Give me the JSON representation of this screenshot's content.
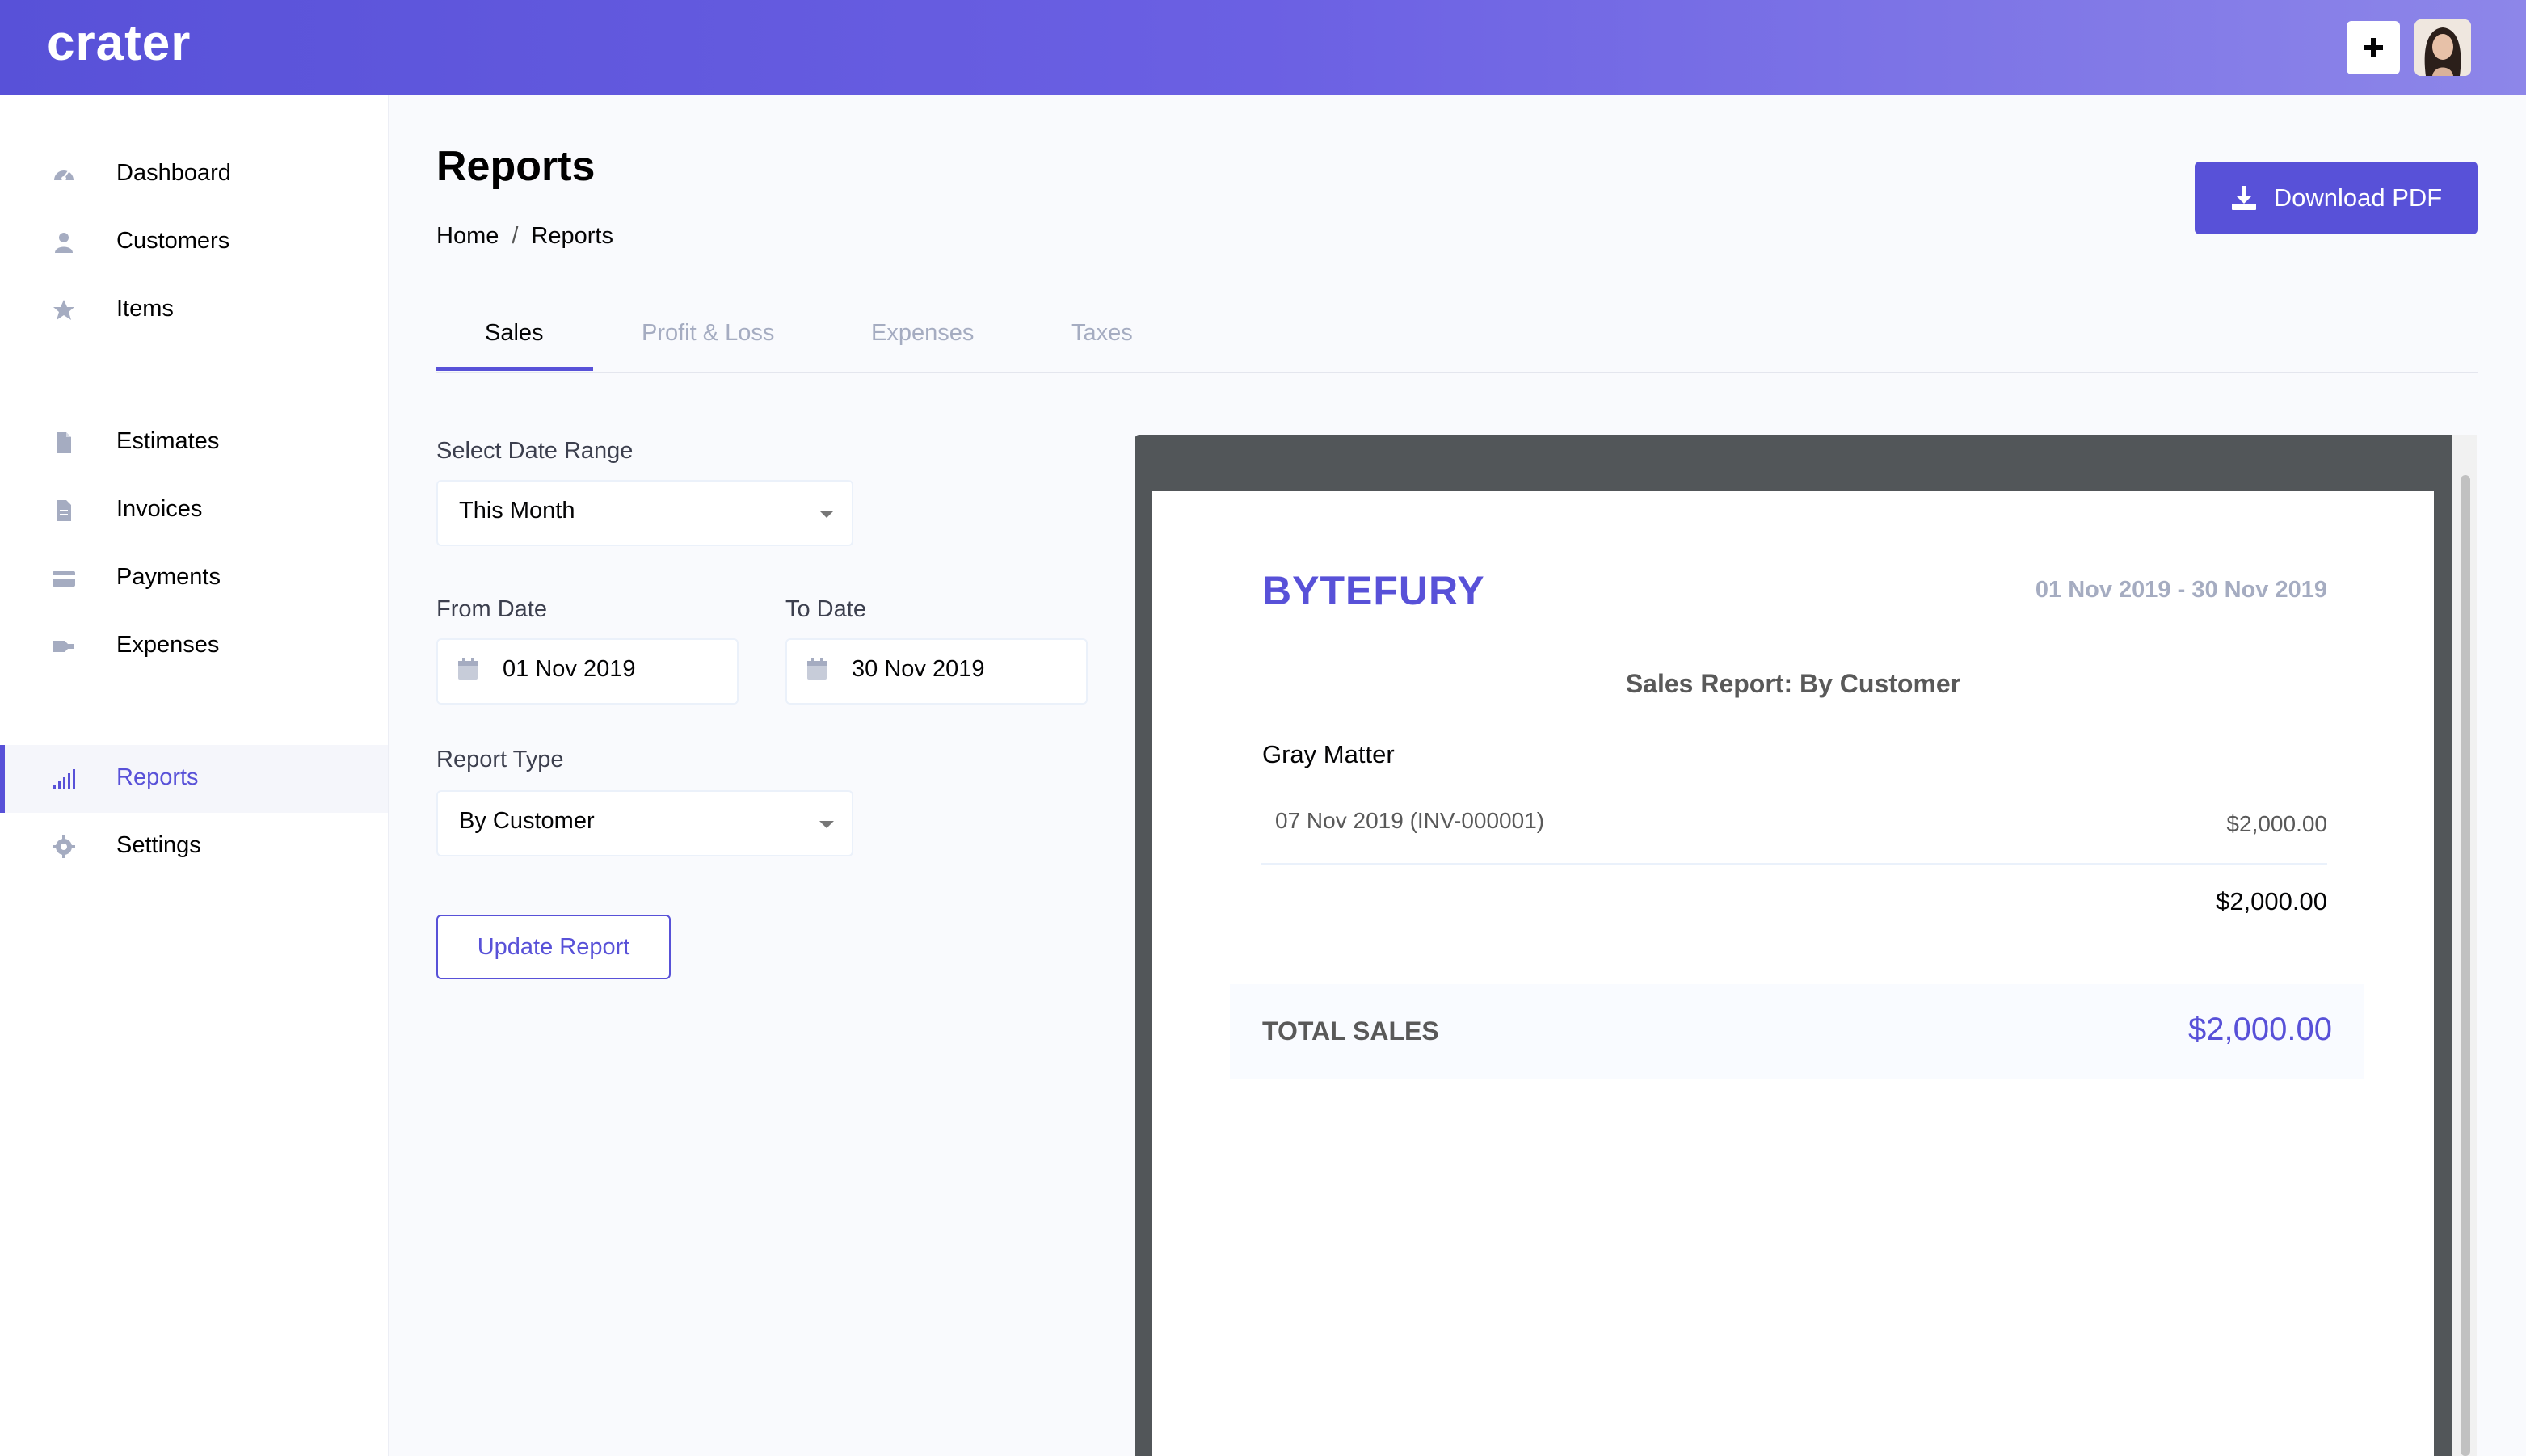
{
  "header": {
    "logo": "crater",
    "plus_icon": "plus-icon",
    "avatar_icon": "user-avatar"
  },
  "sidebar": {
    "items": [
      {
        "label": "Dashboard",
        "icon": "dashboard-icon"
      },
      {
        "label": "Customers",
        "icon": "user-icon"
      },
      {
        "label": "Items",
        "icon": "star-icon"
      },
      {
        "label": "Estimates",
        "icon": "document-icon"
      },
      {
        "label": "Invoices",
        "icon": "file-icon"
      },
      {
        "label": "Payments",
        "icon": "credit-card-icon"
      },
      {
        "label": "Expenses",
        "icon": "key-icon"
      },
      {
        "label": "Reports",
        "icon": "signal-icon",
        "active": true
      },
      {
        "label": "Settings",
        "icon": "gear-icon"
      }
    ]
  },
  "page": {
    "title": "Reports",
    "breadcrumb": {
      "home": "Home",
      "separator": "/",
      "current": "Reports"
    },
    "download_label": "Download PDF"
  },
  "tabs": [
    {
      "label": "Sales",
      "active": true
    },
    {
      "label": "Profit & Loss"
    },
    {
      "label": "Expenses"
    },
    {
      "label": "Taxes"
    }
  ],
  "form": {
    "date_range_label": "Select Date Range",
    "date_range_value": "This Month",
    "from_label": "From Date",
    "from_value": "01 Nov 2019",
    "to_label": "To Date",
    "to_value": "30 Nov 2019",
    "report_type_label": "Report Type",
    "report_type_value": "By Customer",
    "update_label": "Update Report"
  },
  "report": {
    "company": "BYTEFURY",
    "date_range": "01 Nov 2019 - 30 Nov 2019",
    "title": "Sales Report: By Customer",
    "customer": "Gray Matter",
    "invoice_line": "07 Nov 2019 (INV-000001)",
    "invoice_amount": "$2,000.00",
    "subtotal": "$2,000.00",
    "total_label": "TOTAL SALES",
    "total_value": "$2,000.00"
  },
  "colors": {
    "accent": "#5851d8",
    "muted": "#a5acc1",
    "pdf_frame": "#525659"
  }
}
